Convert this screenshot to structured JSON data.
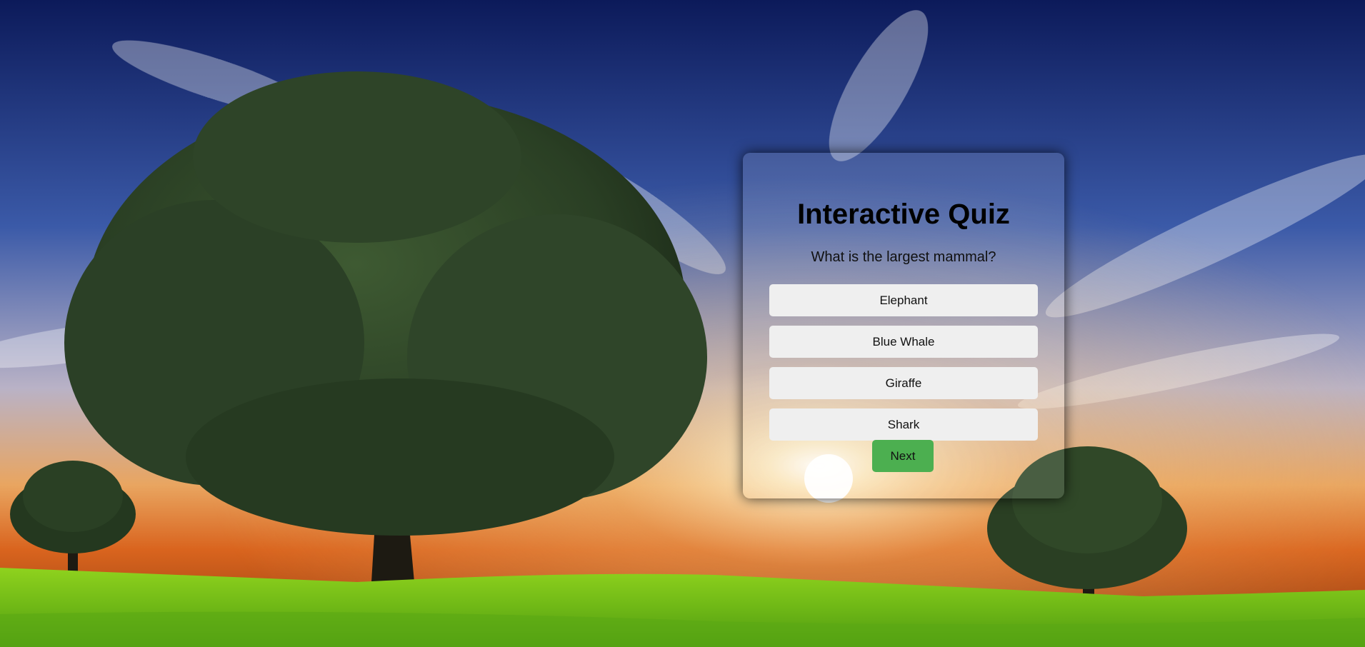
{
  "quiz": {
    "title": "Interactive Quiz",
    "question": "What is the largest mammal?",
    "answers": [
      {
        "label": "Elephant"
      },
      {
        "label": "Blue Whale"
      },
      {
        "label": "Giraffe"
      },
      {
        "label": "Shark"
      }
    ],
    "next_label": "Next"
  },
  "colors": {
    "next_button": "#4caf50",
    "answer_button": "#efefef",
    "sky_top": "#0e1d5e",
    "horizon": "#e8782a",
    "grass": "#7dc219"
  }
}
